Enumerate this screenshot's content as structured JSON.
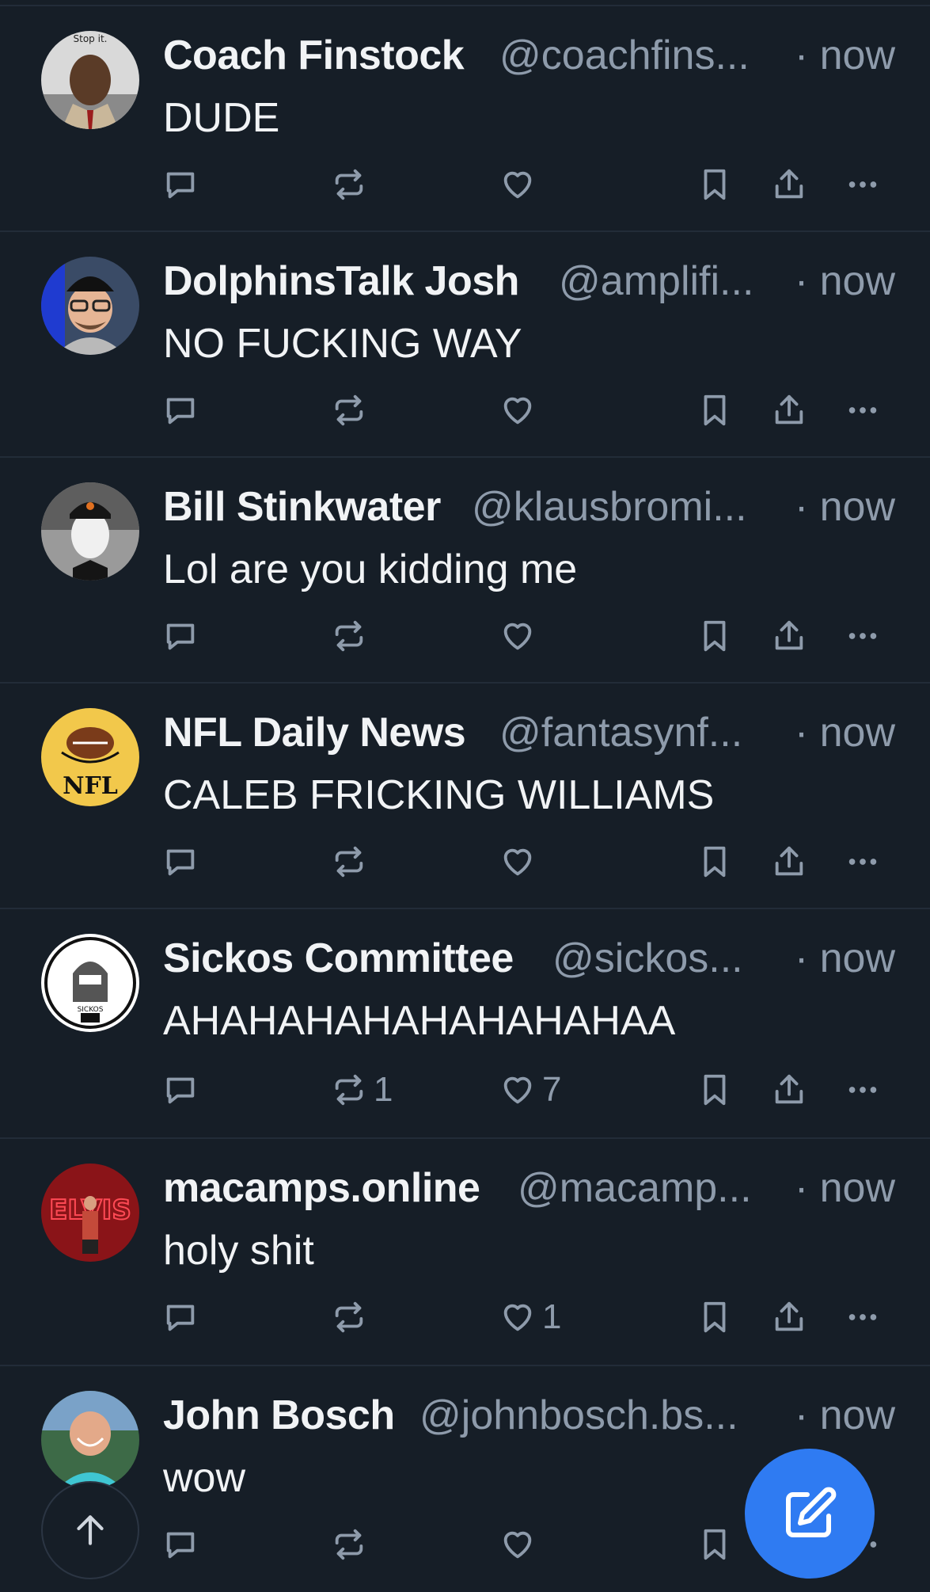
{
  "posts": [
    {
      "name": "Coach Finstock",
      "handle": "@coachfins...",
      "time": "· now",
      "text": "DUDE",
      "reposts": "",
      "likes": "",
      "avatar": "coach-avatar",
      "avatar_text": "Stop it."
    },
    {
      "name": "DolphinsTalk Josh",
      "handle": "@amplifi...",
      "time": "· now",
      "text": "NO FUCKING WAY",
      "reposts": "",
      "likes": "",
      "avatar": "dolphinstalk-avatar",
      "avatar_text": ""
    },
    {
      "name": "Bill Stinkwater",
      "handle": "@klausbromi...",
      "time": "· now",
      "text": "Lol are you kidding me",
      "reposts": "",
      "likes": "",
      "avatar": "bill-avatar",
      "avatar_text": ""
    },
    {
      "name": "NFL Daily News",
      "handle": "@fantasynf...",
      "time": "· now",
      "text": "CALEB FRICKING WILLIAMS",
      "reposts": "",
      "likes": "",
      "avatar": "nfl-avatar",
      "avatar_text": "NFL"
    },
    {
      "name": "Sickos Committee",
      "handle": "@sickos...",
      "time": "· now",
      "text": "AHAHAHAHAHAHAHAHAA",
      "reposts": "1",
      "likes": "7",
      "avatar": "sickos-avatar",
      "avatar_text": "SICKOS"
    },
    {
      "name": "macamps.online",
      "handle": "@macamp...",
      "time": "· now",
      "text": "holy shit",
      "reposts": "",
      "likes": "1",
      "avatar": "macamps-avatar",
      "avatar_text": "ELVIS"
    },
    {
      "name": "John Bosch",
      "handle": "@johnbosch.bs...",
      "time": "· now",
      "text": "wow",
      "reposts": "",
      "likes": "",
      "avatar": "john-avatar",
      "avatar_text": ""
    }
  ],
  "icons": {
    "reply": "reply-icon",
    "repost": "repost-icon",
    "like": "heart-icon",
    "bookmark": "bookmark-icon",
    "share": "share-icon",
    "more": "more-icon",
    "scroll_top": "arrow-up-icon",
    "compose": "compose-icon"
  },
  "colors": {
    "background": "#161e27",
    "divider": "#222c38",
    "text_primary": "#f1f3f5",
    "text_secondary": "#8e9bab",
    "accent": "#2f7bf2"
  }
}
